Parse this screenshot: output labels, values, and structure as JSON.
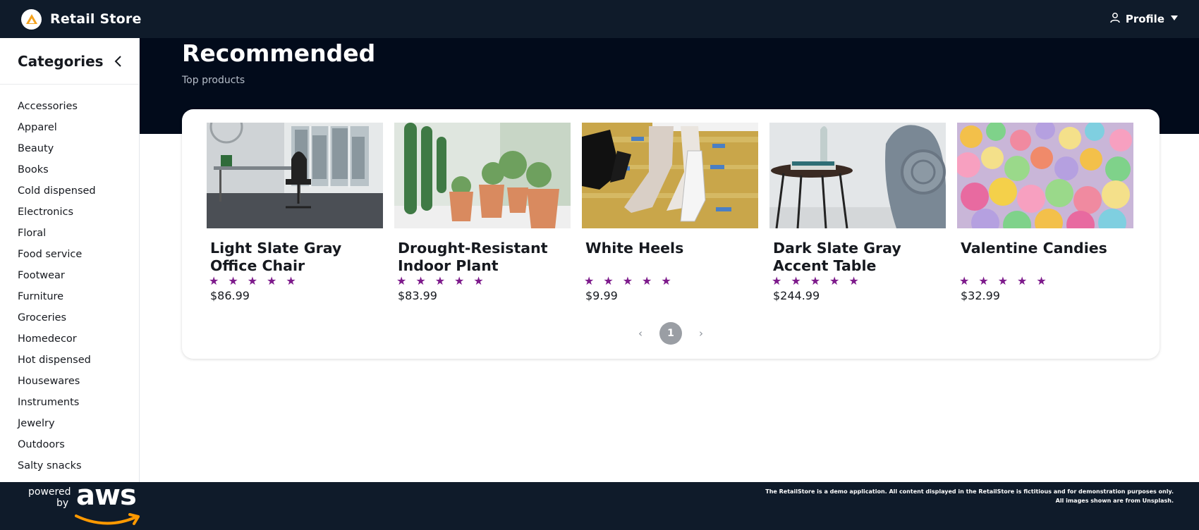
{
  "app": {
    "title": "Retail Store",
    "profile_label": "Profile"
  },
  "sidebar": {
    "title": "Categories",
    "items": [
      {
        "label": "Accessories"
      },
      {
        "label": "Apparel"
      },
      {
        "label": "Beauty"
      },
      {
        "label": "Books"
      },
      {
        "label": "Cold dispensed"
      },
      {
        "label": "Electronics"
      },
      {
        "label": "Floral"
      },
      {
        "label": "Food service"
      },
      {
        "label": "Footwear"
      },
      {
        "label": "Furniture"
      },
      {
        "label": "Groceries"
      },
      {
        "label": "Homedecor"
      },
      {
        "label": "Hot dispensed"
      },
      {
        "label": "Housewares"
      },
      {
        "label": "Instruments"
      },
      {
        "label": "Jewelry"
      },
      {
        "label": "Outdoors"
      },
      {
        "label": "Salty snacks"
      }
    ]
  },
  "hero": {
    "title": "Recommended",
    "subtitle": "Top products"
  },
  "products": [
    {
      "name": "Light Slate Gray Office Chair",
      "rating": 5,
      "stars": "★★★★★",
      "price": "$86.99"
    },
    {
      "name": "Drought-Resistant Indoor Plant",
      "rating": 5,
      "stars": "★★★★★",
      "price": "$83.99"
    },
    {
      "name": "White Heels",
      "rating": 5,
      "stars": "★★★★★",
      "price": "$9.99"
    },
    {
      "name": "Dark Slate Gray Accent Table",
      "rating": 5,
      "stars": "★★★★★",
      "price": "$244.99"
    },
    {
      "name": "Valentine Candies",
      "rating": 5,
      "stars": "★★★★★",
      "price": "$32.99"
    }
  ],
  "pagination": {
    "prev": "‹",
    "current": "1",
    "next": "›"
  },
  "footer": {
    "powered_by": "powered by",
    "powered_line1": "powered",
    "powered_line2": "by",
    "aws_logo_text": "aws",
    "disclaimer_line1": "The RetailStore is a demo application. All content displayed in the RetailStore is fictitious and for demonstration purposes only.",
    "disclaimer_line2": "All images shown are from Unsplash."
  },
  "colors": {
    "nav_bg": "#0f1b2a",
    "hero_bg": "#020b1b",
    "star": "#7d1a8b",
    "aws_orange": "#ff9900"
  }
}
